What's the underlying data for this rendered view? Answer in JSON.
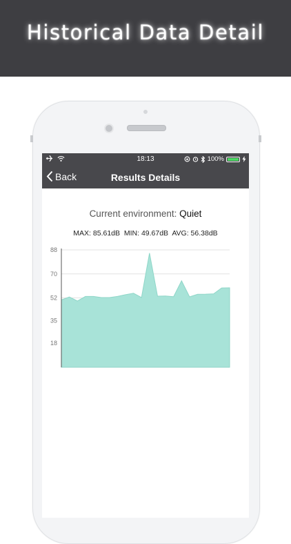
{
  "banner": {
    "title": "Historical Data Detail"
  },
  "status_bar": {
    "time": "18:13",
    "battery": "100%",
    "battery_level": 1.0
  },
  "nav": {
    "back_label": "Back",
    "title": "Results Details"
  },
  "summary": {
    "env_label": "Current environment:",
    "env_value": "Quiet",
    "max": "MAX: 85.61dB",
    "min": "MIN: 49.67dB",
    "avg": "AVG: 56.38dB"
  },
  "colors": {
    "area_fill": "#a8e3d8",
    "area_stroke": "#8fd6c8",
    "nav_bg": "#48484c"
  },
  "chart_data": {
    "type": "area",
    "y_ticks": [
      "88",
      "70",
      "52",
      "35",
      "18"
    ],
    "ylim": [
      0,
      88
    ],
    "grid": true,
    "series": [
      {
        "values": [
          50.5,
          52.7,
          49.7,
          53.1,
          53.1,
          52.3,
          52.3,
          53.1,
          54.4,
          55.5,
          52.3,
          85.6,
          53.3,
          53.4,
          52.9,
          64.8,
          52.8,
          54.7,
          54.8,
          55.1,
          59.5,
          59.6
        ]
      }
    ]
  }
}
